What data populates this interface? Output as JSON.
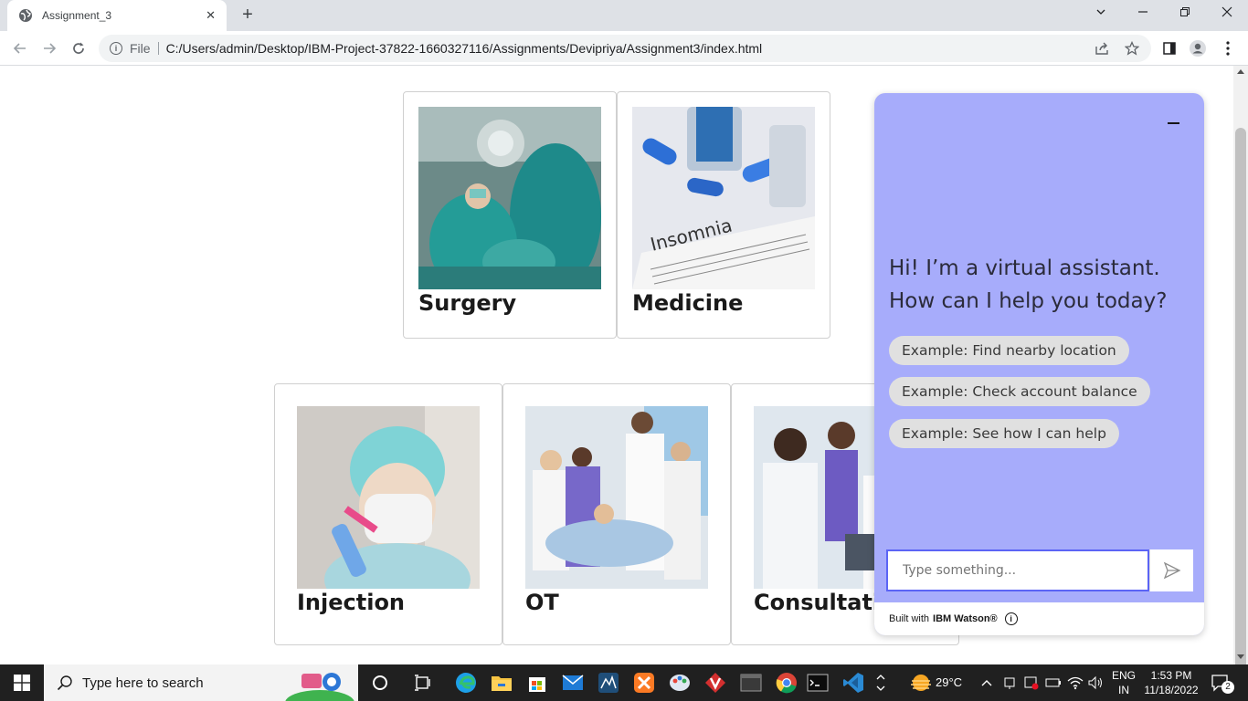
{
  "browser": {
    "tab_title": "Assignment_3",
    "tab_close": "✕",
    "new_tab": "+",
    "scheme": "File",
    "url": "C:/Users/admin/Desktop/IBM-Project-37822-1660327116/Assignments/Devipriya/Assignment3/index.html",
    "window_controls": {
      "chevron": "⌄",
      "minimize": "—",
      "restore": "❐",
      "close": "✕"
    }
  },
  "cards": {
    "row1": [
      {
        "label": "Surgery",
        "image": "surgery-photo"
      },
      {
        "label": "Medicine",
        "image": "medicine-photo"
      }
    ],
    "row2": [
      {
        "label": "Injection",
        "image": "injection-photo"
      },
      {
        "label": "OT",
        "image": "ot-photo"
      },
      {
        "label": "Consultation",
        "image": "consultation-photo"
      }
    ]
  },
  "chat": {
    "greeting": "Hi! I’m a virtual assistant. How can I help you today?",
    "examples": [
      "Example: Find nearby location",
      "Example: Check account balance",
      "Example: See how I can help"
    ],
    "input_placeholder": "Type something...",
    "footer_prefix": "Built with",
    "footer_brand": "IBM Watson®",
    "accent": "#a7acfb"
  },
  "taskbar": {
    "search_placeholder": "Type here to search",
    "weather": "29°C",
    "lang_top": "ENG",
    "lang_bottom": "IN",
    "time": "1:53 PM",
    "date": "11/18/2022",
    "notifications": "2"
  }
}
